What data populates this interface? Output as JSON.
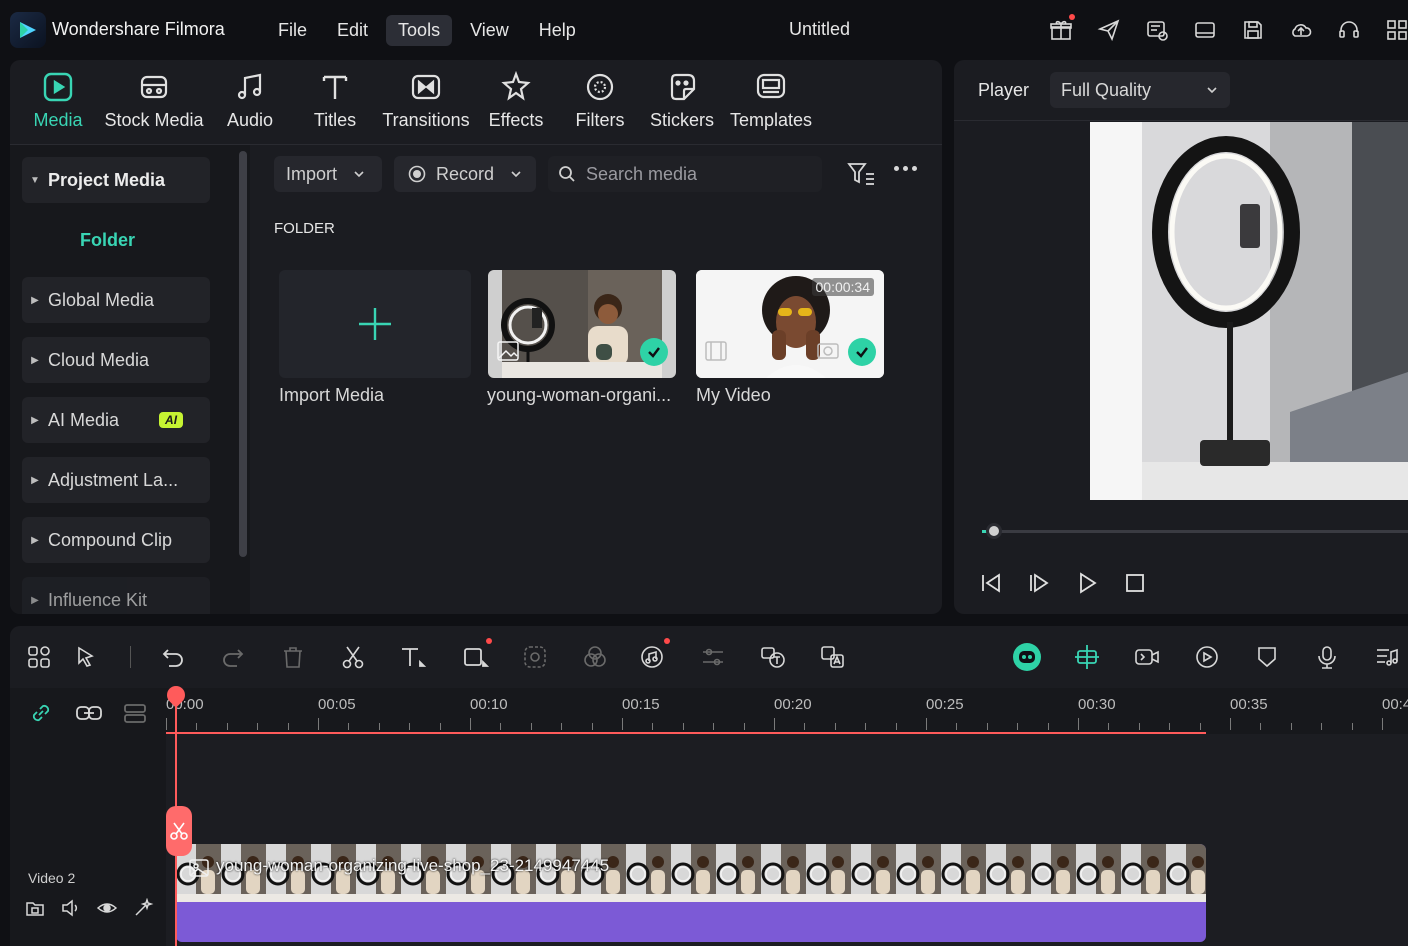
{
  "app": {
    "name": "Wondershare Filmora",
    "document_title": "Untitled",
    "menu": [
      "File",
      "Edit",
      "Tools",
      "View",
      "Help"
    ],
    "active_menu": "Tools",
    "top_icons": [
      "gift-icon",
      "send-icon",
      "project-settings-icon",
      "layout-icon",
      "save-icon",
      "cloud-upload-icon",
      "support-headset-icon",
      "apps-grid-icon"
    ]
  },
  "media_tabs": [
    {
      "label": "Media",
      "icon": "media-icon",
      "active": true
    },
    {
      "label": "Stock Media",
      "icon": "stock-media-icon"
    },
    {
      "label": "Audio",
      "icon": "audio-note-icon"
    },
    {
      "label": "Titles",
      "icon": "titles-t-icon"
    },
    {
      "label": "Transitions",
      "icon": "transitions-icon"
    },
    {
      "label": "Effects",
      "icon": "effects-icon"
    },
    {
      "label": "Filters",
      "icon": "filters-icon"
    },
    {
      "label": "Stickers",
      "icon": "stickers-icon"
    },
    {
      "label": "Templates",
      "icon": "templates-icon"
    }
  ],
  "sidebar": {
    "project_media": "Project Media",
    "folder": "Folder",
    "items": [
      "Global Media",
      "Cloud Media",
      "AI Media",
      "Adjustment La...",
      "Compound Clip",
      "Influence Kit"
    ],
    "ai_badge": "AI"
  },
  "toolbar": {
    "import_label": "Import",
    "record_label": "Record",
    "search_placeholder": "Search media"
  },
  "folder_heading": "FOLDER",
  "media_items": [
    {
      "label": "Import Media"
    },
    {
      "label": "young-woman-organi..."
    },
    {
      "label": "My Video",
      "duration": "00:00:34"
    }
  ],
  "player": {
    "label": "Player",
    "quality": "Full Quality",
    "progress": 0.0
  },
  "timeline": {
    "ruler_labels": [
      "00:00",
      "00:05",
      "00:10",
      "00:15",
      "00:20",
      "00:25",
      "00:30",
      "00:35",
      "00:4"
    ],
    "track_name": "Video 2",
    "clip_name": "young-woman-organizing-live-shop_23-2149947445"
  },
  "colors": {
    "accent": "#39d5b4",
    "playhead": "#ff5b5b",
    "clip": "#7c5ad6",
    "ai_badge": "#c6f432"
  }
}
